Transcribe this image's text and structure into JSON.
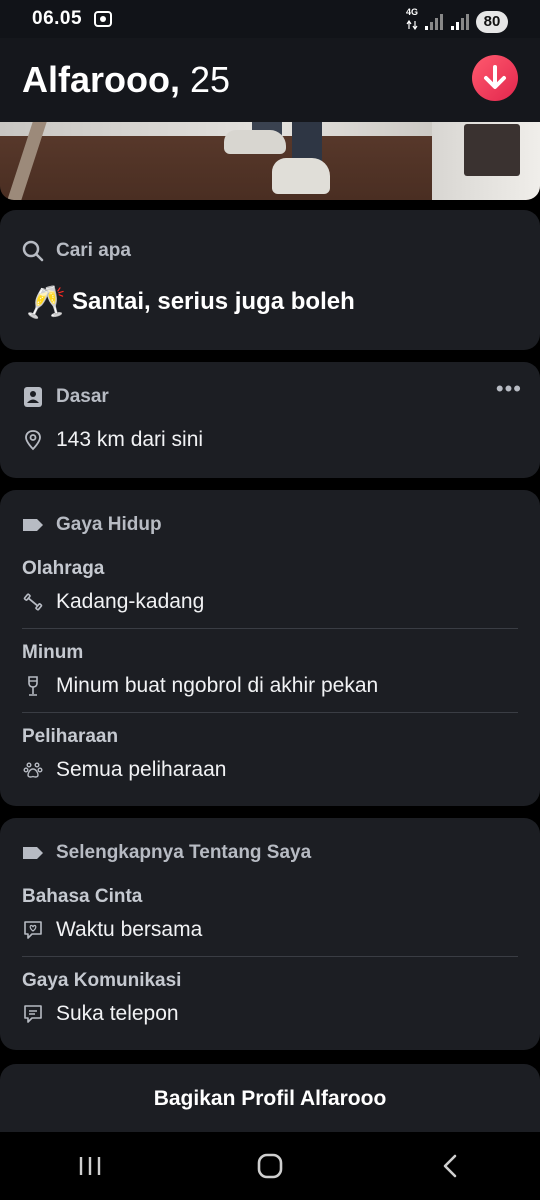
{
  "status_bar": {
    "time": "06.05",
    "network": "4G",
    "battery": "80"
  },
  "header": {
    "name": "Alfarooo,",
    "age": "25",
    "action_icon": "arrow-down-icon",
    "accent_color": "#f4344f"
  },
  "looking_for": {
    "label": "Cari apa",
    "emoji": "🥂",
    "value": "Santai, serius juga boleh"
  },
  "basics": {
    "label": "Dasar",
    "more": "•••",
    "distance": "143 km dari sini"
  },
  "lifestyle": {
    "label": "Gaya Hidup",
    "items": [
      {
        "label": "Olahraga",
        "value": "Kadang-kadang",
        "icon": "dumbbell-icon"
      },
      {
        "label": "Minum",
        "value": "Minum buat ngobrol di akhir pekan",
        "icon": "wine-glass-icon"
      },
      {
        "label": "Peliharaan",
        "value": "Semua peliharaan",
        "icon": "paw-icon"
      }
    ]
  },
  "more_about": {
    "label": "Selengkapnya Tentang Saya",
    "items": [
      {
        "label": "Bahasa Cinta",
        "value": "Waktu bersama",
        "icon": "love-chat-icon"
      },
      {
        "label": "Gaya Komunikasi",
        "value": "Suka telepon",
        "icon": "chat-icon"
      }
    ]
  },
  "share": {
    "label": "Bagikan Profil Alfarooo"
  }
}
